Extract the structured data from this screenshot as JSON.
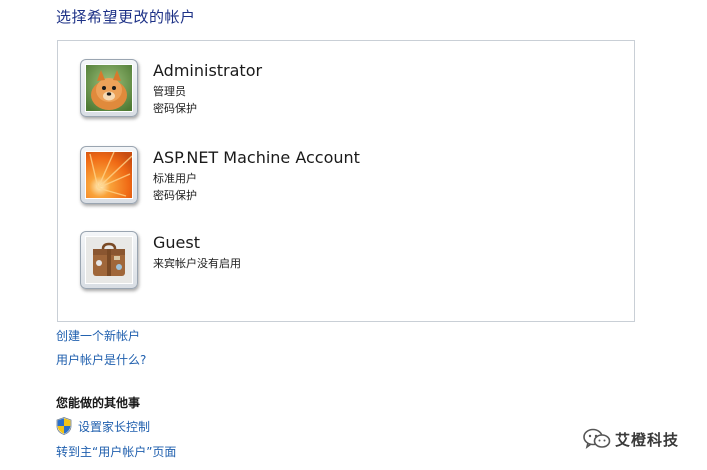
{
  "page": {
    "title": "选择希望更改的帐户"
  },
  "accounts": [
    {
      "name": "Administrator",
      "role": "管理员",
      "status": "密码保护",
      "picture": "pomeranian-dog-picture"
    },
    {
      "name": "ASP.NET Machine Account",
      "role": "标准用户",
      "status": "密码保护",
      "picture": "orange-flower-picture"
    },
    {
      "name": "Guest",
      "role": "来宾帐户没有启用",
      "status": "",
      "picture": "suitcase-picture"
    }
  ],
  "links": {
    "create_account": "创建一个新帐户",
    "what_is_account": "用户帐户是什么?",
    "goto_main": "转到主“用户帐户”页面"
  },
  "other_tasks": {
    "heading": "您能做的其他事",
    "parental_controls": "设置家长控制",
    "parental_icon": "uac-shield-icon"
  },
  "watermark": {
    "text": "艾橙科技",
    "icon": "wechat-logo-icon"
  },
  "colors": {
    "title": "#1e3287",
    "link": "#1f5fae",
    "panel_border": "#c9cfd6"
  }
}
